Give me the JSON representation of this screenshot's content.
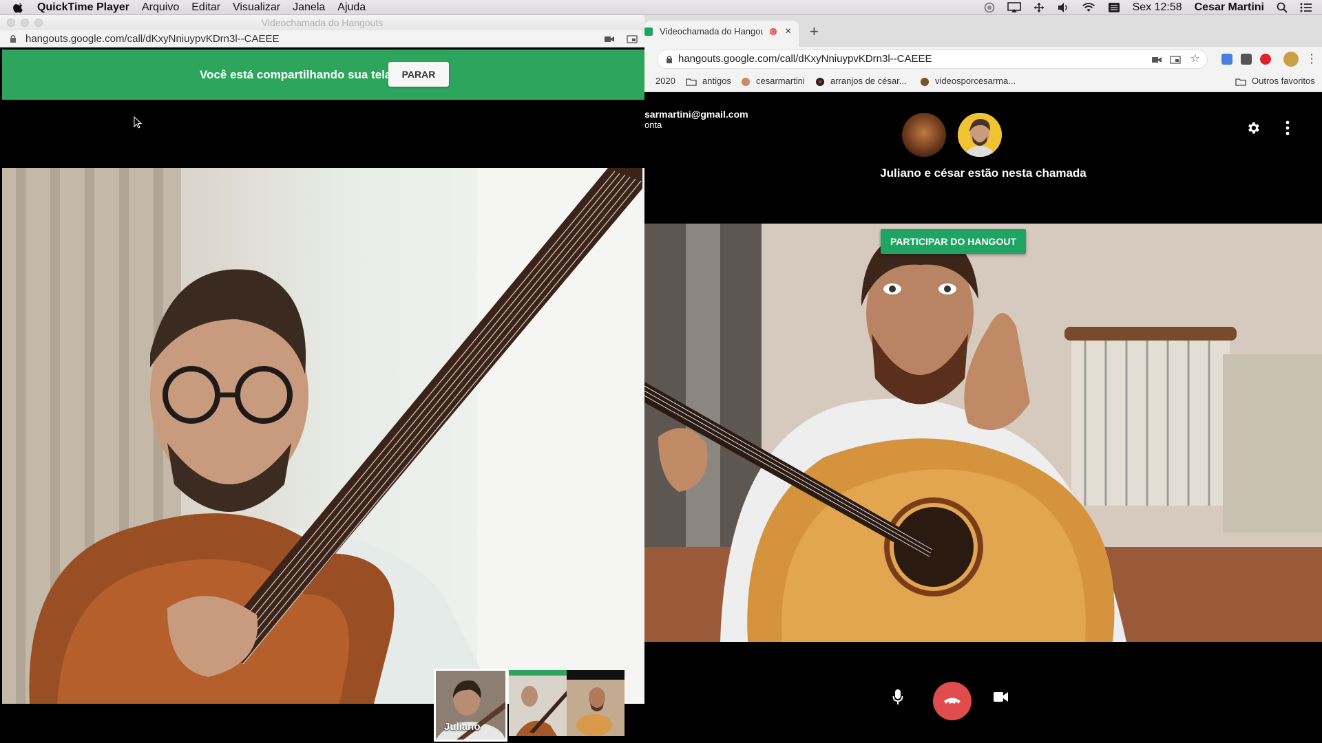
{
  "menubar": {
    "app_name": "QuickTime Player",
    "menus": [
      "Arquivo",
      "Editar",
      "Visualizar",
      "Janela",
      "Ajuda"
    ],
    "clock": "Sex 12:58",
    "user": "Cesar Martini"
  },
  "quicktime": {
    "window_title": "Videochamada do Hangouts",
    "url": "hangouts.google.com/call/dKxyNniuypvKDrn3l--CAEEE",
    "share_message": "Você está compartilhando sua tela",
    "stop_button": "PARAR",
    "thumbnail_label": "Juliano"
  },
  "chrome": {
    "tab_title": "Videochamada do Hangouts",
    "tab_close": "×",
    "new_tab": "+",
    "url": "hangouts.google.com/call/dKxyNniuypvKDrn3l--CAEEE",
    "bookmarks": [
      "2020",
      "antigos",
      "cesarmartini",
      "arranjos de césar...",
      "videosporcesarma..."
    ],
    "other_bookmarks": "Outros favoritos"
  },
  "hangout": {
    "account_email": "sarmartini@gmail.com",
    "account_sub": "onta",
    "participants_text": "Juliano e césar estão nesta chamada",
    "join_button": "PARTICIPAR DO HANGOUT"
  },
  "colors": {
    "share_banner": "#2da55c",
    "join_button": "#1fa463",
    "hangup": "#e04c4c"
  }
}
